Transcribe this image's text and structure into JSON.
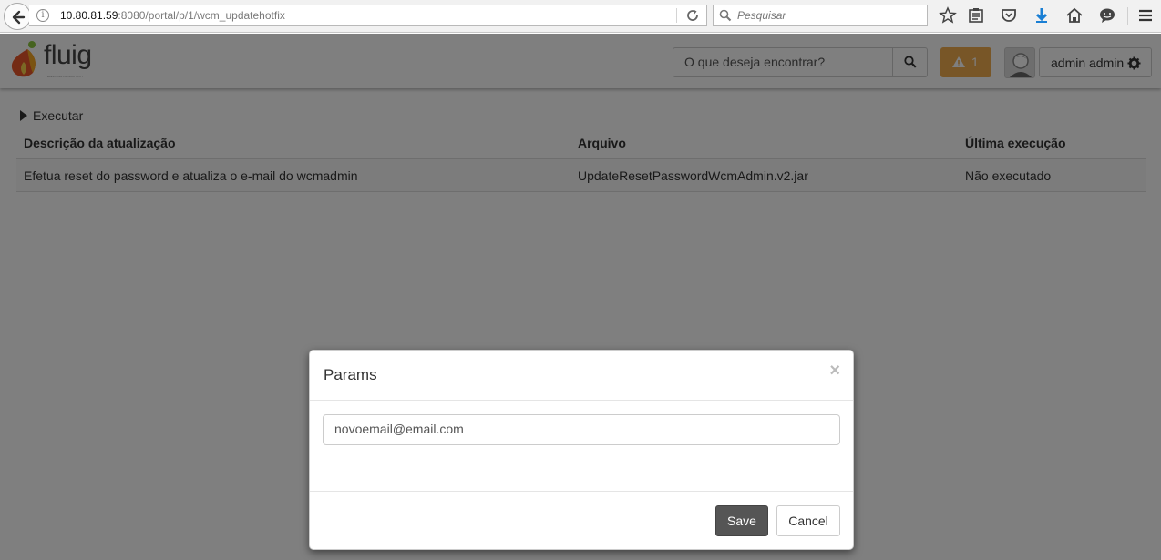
{
  "browser": {
    "url_host": "10.80.81.59",
    "url_rest": ":8080/portal/p/1/wcm_updatehotfix",
    "search_placeholder": "Pesquisar"
  },
  "header": {
    "logo_text": "fluig",
    "logo_sub": "ELEVATING PRODUCTIVITY",
    "search_placeholder": "O que deseja encontrar?",
    "alert_count": "1",
    "user_name": "admin admin"
  },
  "page": {
    "exec_label": "Executar",
    "columns": [
      "Descrição da atualização",
      "Arquivo",
      "Última execução"
    ],
    "rows": [
      [
        "Efetua reset do password e atualiza o e-mail do wcmadmin",
        "UpdateResetPasswordWcmAdmin.v2.jar",
        "Não executado"
      ]
    ]
  },
  "modal": {
    "title": "Params",
    "close": "×",
    "input_value": "novoemail@email.com",
    "save_label": "Save",
    "cancel_label": "Cancel"
  },
  "colors": {
    "alert": "#f0ad4e",
    "save_button": "#555555",
    "backdrop": "rgba(0,0,0,0.5)"
  }
}
